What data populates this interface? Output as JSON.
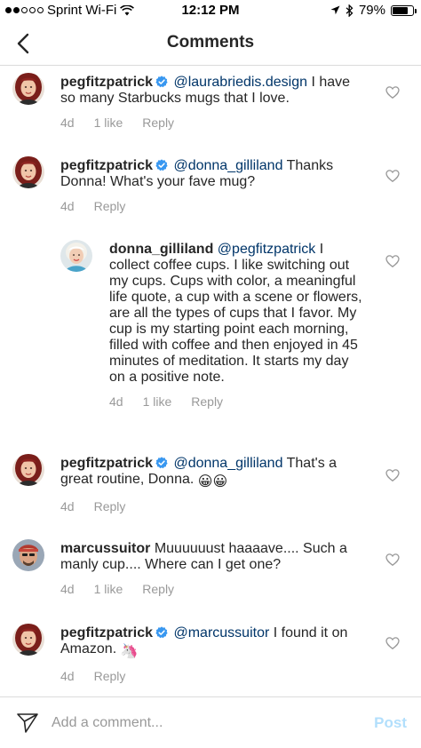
{
  "status_bar": {
    "carrier": "Sprint Wi-Fi",
    "time": "12:12 PM",
    "battery": "79%",
    "battery_level": 0.79
  },
  "header": {
    "title": "Comments"
  },
  "comments": [
    {
      "username": "pegfitzpatrick",
      "verified": true,
      "mention": "@laurabriedis.design",
      "text": "I have so many Starbucks mugs that I love.",
      "time": "4d",
      "likes": "1 like",
      "reply": "Reply"
    },
    {
      "username": "pegfitzpatrick",
      "verified": true,
      "mention": "@donna_gilliland",
      "text": "Thanks Donna! What's your fave mug?",
      "time": "4d",
      "reply": "Reply"
    },
    {
      "username": "donna_gilliland",
      "verified": false,
      "mention": "@pegfitzpatrick",
      "text": "I collect coffee cups. I like switching out my cups. Cups with color, a meaningful life quote, a cup with a scene or flowers, are all the types of cups that I favor. My cup is my starting point each morning, filled with coffee and then enjoyed in 45 minutes of meditation. It starts my day on a positive note.",
      "time": "4d",
      "likes": "1 like",
      "reply": "Reply"
    },
    {
      "username": "pegfitzpatrick",
      "verified": true,
      "mention": "@donna_gilliland",
      "text": "That's a great routine, Donna.",
      "emoji": "😀😀",
      "time": "4d",
      "reply": "Reply"
    },
    {
      "username": "marcussuitor",
      "verified": false,
      "text": "Muuuuuust haaaave.... Such a manly cup.... Where can I get one?",
      "time": "4d",
      "likes": "1 like",
      "reply": "Reply"
    },
    {
      "username": "pegfitzpatrick",
      "verified": true,
      "mention": "@marcussuitor",
      "text": "I found it on Amazon.",
      "emoji": "🦄",
      "time": "4d",
      "reply": "Reply"
    }
  ],
  "comment_bar": {
    "placeholder": "Add a comment...",
    "post_label": "Post"
  },
  "colors": {
    "mention": "#003569",
    "muted": "#999999",
    "verified": "#3897f0",
    "post_disabled": "#b2dffc"
  }
}
